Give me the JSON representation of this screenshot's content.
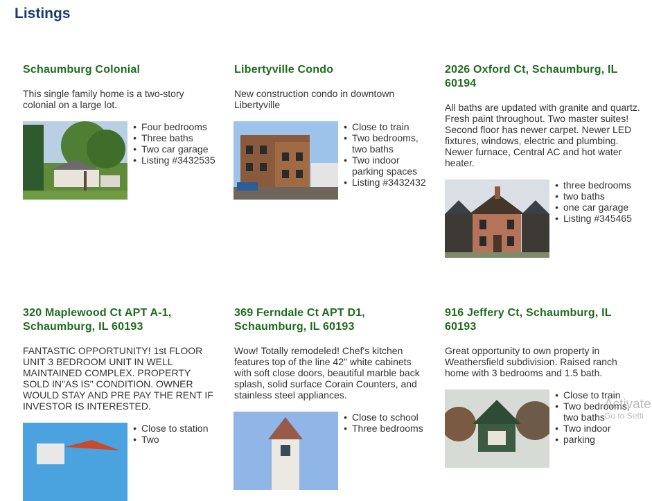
{
  "page": {
    "title": "Listings"
  },
  "listings": [
    {
      "title": "Schaumburg Colonial",
      "description": "This single family home is a two-story colonial on a large lot.",
      "features": [
        "Four bedrooms",
        "Three baths",
        "Two car garage",
        "Listing #3432535"
      ]
    },
    {
      "title": "Libertyville Condo",
      "description": "New construction condo in downtown Libertyville",
      "features": [
        "Close to train",
        "Two bedrooms, two baths",
        "Two indoor parking spaces",
        "Listing #3432432"
      ]
    },
    {
      "title": "2026 Oxford Ct, Schaumburg, IL 60194",
      "description": "All baths are updated with granite and quartz. Fresh paint throughout. Two master suites! Second floor has newer carpet. Newer LED fixtures, windows, electric and plumbing. Newer furnace, Central AC and hot water heater.",
      "features": [
        "three bedrooms",
        "two baths",
        "one car garage",
        "Listing #345465"
      ]
    },
    {
      "title": "320 Maplewood Ct APT A-1, Schaumburg, IL 60193",
      "description": "FANTASTIC OPPORTUNITY! 1st FLOOR UNIT 3 BEDROOM UNIT IN WELL MAINTAINED COMPLEX. PROPERTY SOLD IN\"AS IS\" CONDITION. OWNER WOULD STAY AND PRE PAY THE RENT IF INVESTOR IS INTERESTED.",
      "features": [
        "Close to station",
        "Two"
      ]
    },
    {
      "title": "369 Ferndale Ct APT D1, Schaumburg, IL 60193",
      "description": "Wow! Totally remodeled! Chef's kitchen features top of the line 42\" white cabinets with soft close doors, beautiful marble back splash, solid surface Corain Counters, and stainless steel appliances.",
      "features": [
        "Close to school",
        "Three bedrooms"
      ]
    },
    {
      "title": "916 Jeffery Ct, Schaumburg, IL 60193",
      "description": "Great opportunity to own property in Weathersfield subdivision. Raised ranch home with 3 bedrooms and 1.5 bath.",
      "features": [
        "Close to train",
        "Two bedrooms, two baths",
        "Two indoor",
        "parking"
      ]
    }
  ],
  "watermark": {
    "line1": "Activate",
    "line2": "Go to Setti"
  },
  "colors": {
    "heading": "#1a3a6b",
    "listing_title": "#1e6b1e",
    "text": "#333333"
  }
}
